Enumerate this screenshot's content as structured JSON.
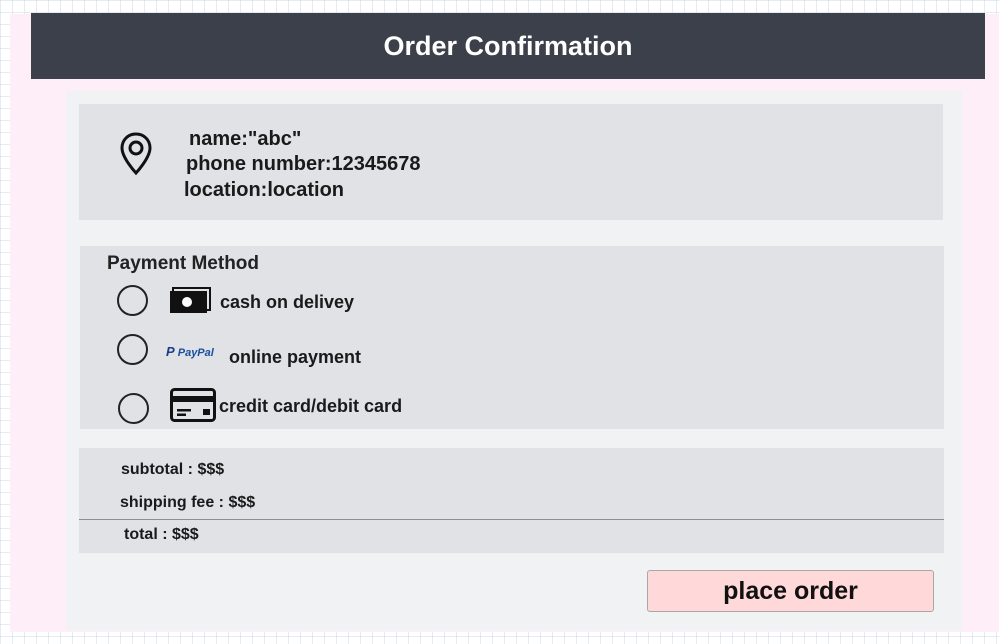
{
  "header": {
    "title": "Order Confirmation"
  },
  "address": {
    "icon": "location-pin-icon",
    "name": "name:\"abc\"",
    "phone": "phone number:12345678",
    "location": "location:location"
  },
  "payment": {
    "title": "Payment Method",
    "options": [
      {
        "label": "cash on delivey",
        "icon": "cash-icon"
      },
      {
        "label": "online payment",
        "icon": "paypal-logo",
        "logo_text": "PayPal"
      },
      {
        "label": "credit card/debit card",
        "icon": "credit-card-icon"
      }
    ]
  },
  "summary": {
    "subtotal": "subtotal : $$$",
    "shipping": "shipping fee : $$$",
    "total": "total : $$$"
  },
  "actions": {
    "place_order": "place order"
  },
  "colors": {
    "header_bg": "#3c404a",
    "panel_bg": "#e0e2e6",
    "card_bg": "#f1f2f4",
    "button_bg": "#ffd9d9",
    "page_bg": "#fdeef7"
  }
}
